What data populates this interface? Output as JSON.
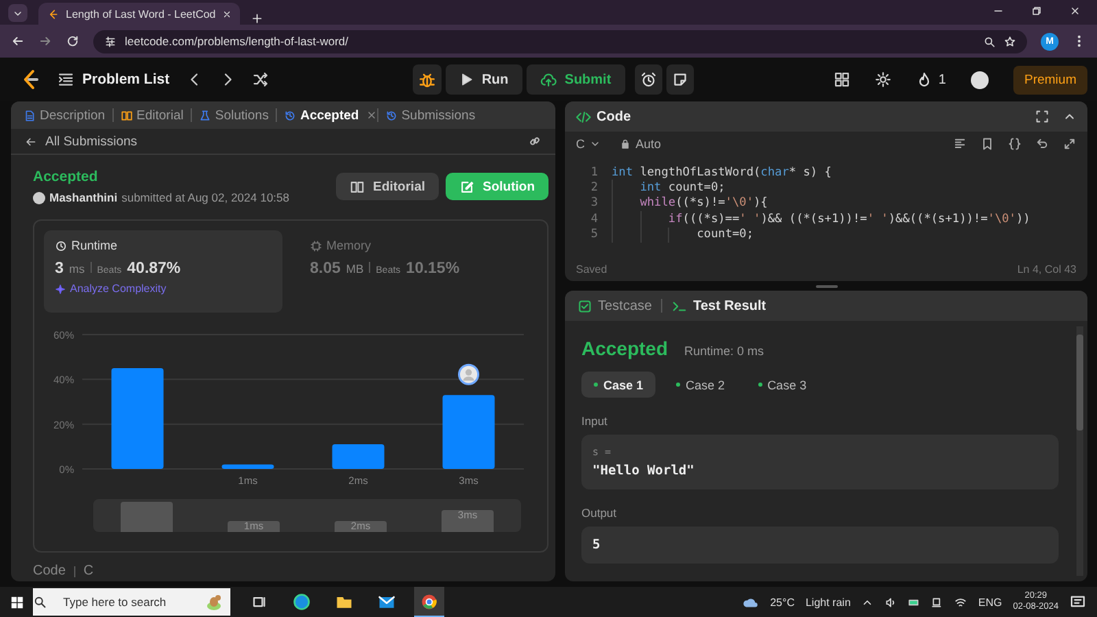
{
  "browser": {
    "tab_title": "Length of Last Word - LeetCod",
    "url": "leetcode.com/problems/length-of-last-word/",
    "profile_initial": "M"
  },
  "header": {
    "problem_list": "Problem List",
    "run": "Run",
    "submit": "Submit",
    "streak": "1",
    "premium": "Premium"
  },
  "left_panel": {
    "tabs": [
      {
        "label": "Description",
        "selected": false,
        "closable": false
      },
      {
        "label": "Editorial",
        "selected": false,
        "closable": false
      },
      {
        "label": "Solutions",
        "selected": false,
        "closable": false
      },
      {
        "label": "Accepted",
        "selected": true,
        "closable": true
      },
      {
        "label": "Submissions",
        "selected": false,
        "closable": false
      }
    ],
    "back_link": "All Submissions",
    "status": "Accepted",
    "user": "Mashanthini",
    "submitted": "submitted at Aug 02, 2024 10:58",
    "buttons": [
      {
        "kind": "secondary",
        "label": "Editorial"
      },
      {
        "kind": "primary",
        "label": "Solution"
      }
    ],
    "metrics": [
      {
        "title": "Runtime",
        "value": "3",
        "unit": "ms",
        "beats_label": "Beats",
        "beats": "40.87%",
        "selected": true,
        "link": "Analyze Complexity"
      },
      {
        "title": "Memory",
        "value": "8.05",
        "unit": "MB",
        "beats_label": "Beats",
        "beats": "10.15%",
        "selected": false
      }
    ],
    "chart_data": {
      "type": "bar",
      "categories": [
        null,
        "1ms",
        "2ms",
        "3ms"
      ],
      "values": [
        45,
        2,
        11,
        33
      ],
      "ylim": [
        0,
        60
      ],
      "yticks": [
        {
          "value": 0,
          "label": "0%"
        },
        {
          "value": 20,
          "label": "20%"
        },
        {
          "value": 40,
          "label": "40%"
        },
        {
          "value": 60,
          "label": "60%"
        }
      ]
    },
    "overview": [
      "1ms",
      "2ms",
      "3ms"
    ],
    "code_label": "Code",
    "code_language": "C"
  },
  "code_panel": {
    "title": "Code",
    "language": "C",
    "mode": "Auto",
    "lines": [
      {
        "number": "1",
        "tokens": [
          {
            "kind": "type",
            "text": "int"
          },
          {
            "kind": "plain",
            "text": " lengthOfLastWord("
          },
          {
            "kind": "type",
            "text": "char"
          },
          {
            "kind": "plain",
            "text": "* s) {"
          }
        ],
        "children": [
          {
            "number": "2",
            "tokens": [
              {
                "kind": "type",
                "text": "int"
              },
              {
                "kind": "plain",
                "text": " count=0;"
              }
            ]
          },
          {
            "number": "3",
            "tokens": [
              {
                "kind": "control",
                "text": "while"
              },
              {
                "kind": "plain",
                "text": "((*s)!="
              },
              {
                "kind": "string",
                "text": "'\\0'"
              },
              {
                "kind": "plain",
                "text": "){"
              }
            ],
            "children": [
              {
                "number": "4",
                "tokens": [
                  {
                    "kind": "control",
                    "text": "if"
                  },
                  {
                    "kind": "plain",
                    "text": "(((*s)=="
                  },
                  {
                    "kind": "string",
                    "text": "' '"
                  },
                  {
                    "kind": "plain",
                    "text": ")&& ((*(s+1))!="
                  },
                  {
                    "kind": "string",
                    "text": "' '"
                  },
                  {
                    "kind": "plain",
                    "text": ")&&((*(s+1))!="
                  },
                  {
                    "kind": "string",
                    "text": "'\\0'"
                  },
                  {
                    "kind": "plain",
                    "text": "))"
                  }
                ],
                "children": [
                  {
                    "number": "5",
                    "tokens": [
                      {
                        "kind": "plain",
                        "text": "count=0;"
                      }
                    ]
                  }
                ]
              }
            ]
          }
        ]
      }
    ],
    "status": "Saved",
    "cursor": "Ln 4, Col 43"
  },
  "result_panel": {
    "tabs": [
      {
        "label": "Testcase",
        "selected": false
      },
      {
        "label": "Test Result",
        "selected": true
      }
    ],
    "verdict": "Accepted",
    "runtime": "Runtime: 0 ms",
    "cases": [
      {
        "label": "Case 1",
        "selected": true
      },
      {
        "label": "Case 2",
        "selected": false
      },
      {
        "label": "Case 3",
        "selected": false
      }
    ],
    "sections": [
      {
        "label": "Input",
        "param": "s =",
        "value": "\"Hello World\""
      },
      {
        "label": "Output",
        "value": "5"
      }
    ]
  },
  "taskbar": {
    "search_placeholder": "Type here to search",
    "temperature": "25°C",
    "weather": "Light rain",
    "language": "ENG",
    "time": "20:29",
    "date": "02-08-2024"
  }
}
